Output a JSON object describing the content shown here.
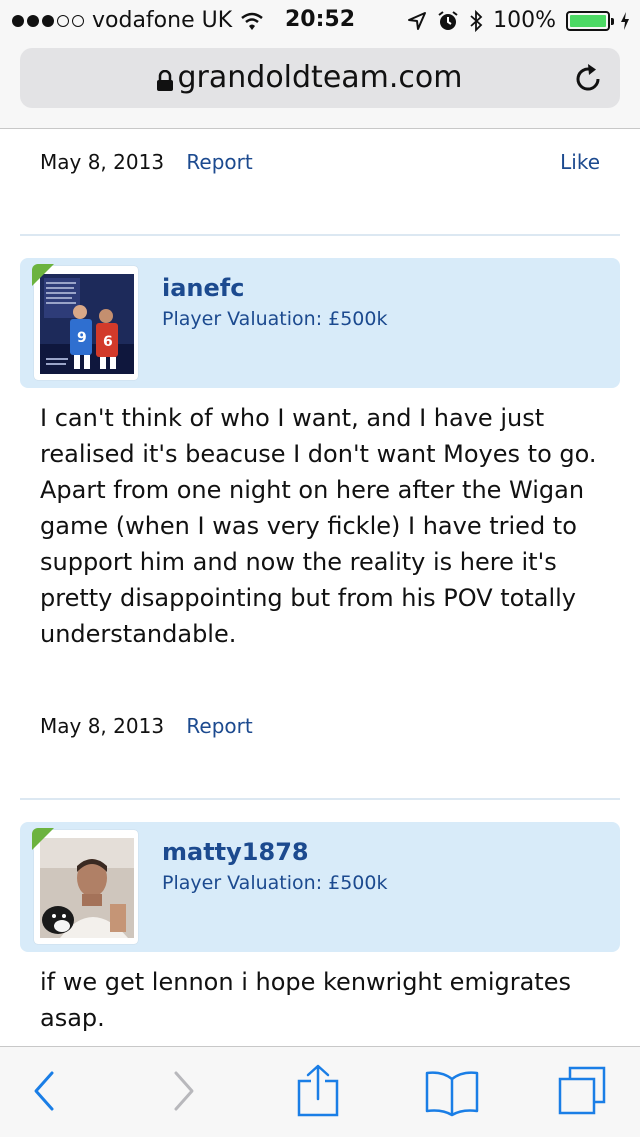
{
  "status_bar": {
    "carrier": "vodafone UK",
    "time": "20:52",
    "battery": "100%"
  },
  "browser": {
    "url": "grandoldteam.com"
  },
  "posts": [
    {
      "date": "May 8, 2013",
      "report_label": "Report",
      "like_label": "Like"
    },
    {
      "username": "ianefc",
      "valuation": "Player Valuation: £500k",
      "text": "I can't think of who I want, and I have just realised it's beacuse I don't want Moyes to go. Apart from one night on here after the Wigan game (when I was very fickle) I have tried to support him and now the reality is here it's pretty disappointing but from his POV totally understandable.",
      "date": "May 8, 2013",
      "report_label": "Report"
    },
    {
      "username": "matty1878",
      "valuation": "Player Valuation: £500k",
      "text": "if we get lennon i hope kenwright emigrates asap."
    }
  ],
  "colors": {
    "link": "#1c4a8f",
    "card_bg": "#d8ebf9",
    "toolbar_icon": "#1a7ee6",
    "corner_tab": "#6cb33f"
  }
}
